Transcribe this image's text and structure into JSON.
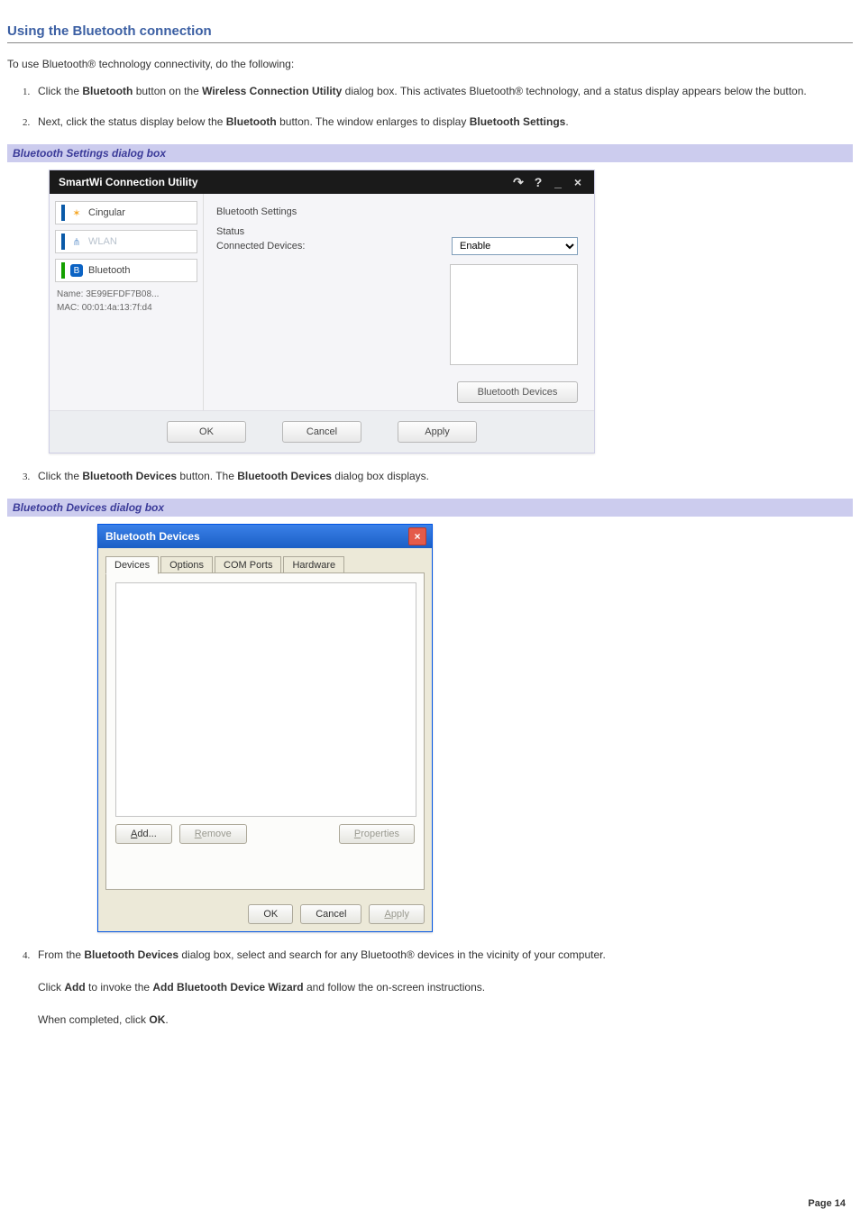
{
  "page": {
    "title": "Using the Bluetooth connection",
    "intro": "To use Bluetooth® technology connectivity, do the following:",
    "page_number": "Page 14"
  },
  "steps": {
    "s1_a": "Click the ",
    "s1_b": "Bluetooth",
    "s1_c": " button on the ",
    "s1_d": "Wireless Connection Utility",
    "s1_e": " dialog box. This activates Bluetooth® technology, and a status display appears below the button.",
    "s2_a": "Next, click the status display below the ",
    "s2_b": "Bluetooth",
    "s2_c": " button. The window enlarges to display ",
    "s2_d": "Bluetooth Settings",
    "s2_e": ".",
    "s3_a": "Click the ",
    "s3_b": "Bluetooth Devices",
    "s3_c": " button. The ",
    "s3_d": "Bluetooth Devices",
    "s3_e": " dialog box displays.",
    "s4_a": "From the ",
    "s4_b": "Bluetooth Devices",
    "s4_c": " dialog box, select and search for any Bluetooth® devices in the vicinity of your computer.",
    "s4p2_a": "Click ",
    "s4p2_b": "Add",
    "s4p2_c": " to invoke the ",
    "s4p2_d": "Add Bluetooth Device Wizard",
    "s4p2_e": " and follow the on-screen instructions.",
    "s4p3_a": "When completed, click ",
    "s4p3_b": "OK",
    "s4p3_c": "."
  },
  "caption1": "Bluetooth Settings dialog box",
  "caption2": "Bluetooth Devices dialog box",
  "smartwi": {
    "title": "SmartWi Connection Utility",
    "left": {
      "cingular": "Cingular",
      "wlan": "WLAN",
      "bluetooth": "Bluetooth",
      "name_label": "Name:",
      "name_value": "3E99EFDF7B08...",
      "mac_label": "MAC:",
      "mac_value": "00:01:4a:13:7f:d4"
    },
    "right": {
      "panel_title": "Bluetooth Settings",
      "status_label": "Status",
      "connected_label": "Connected Devices:",
      "enable_option": "Enable",
      "bt_devices_btn": "Bluetooth Devices"
    },
    "footer": {
      "ok": "OK",
      "cancel": "Cancel",
      "apply": "Apply"
    }
  },
  "btd": {
    "title": "Bluetooth Devices",
    "tabs": {
      "devices": "Devices",
      "options": "Options",
      "com": "COM Ports",
      "hardware": "Hardware"
    },
    "buttons": {
      "add": "Add...",
      "remove": "Remove",
      "properties": "Properties",
      "ok": "OK",
      "cancel": "Cancel",
      "apply": "Apply"
    }
  }
}
